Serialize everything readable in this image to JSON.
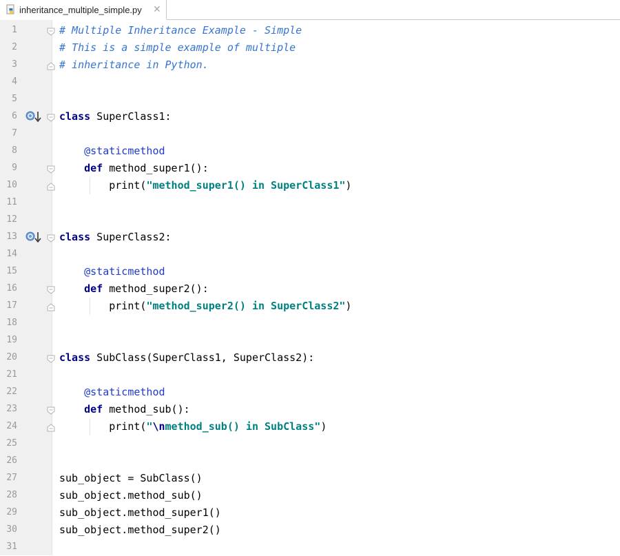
{
  "tab": {
    "filename": "inheritance_multiple_simple.py",
    "close": "✕"
  },
  "icons": {
    "file": "python-file-icon",
    "override": "override-method-icon"
  },
  "colors": {
    "keyword": "#000080",
    "comment": "#3574d1",
    "string": "#008080",
    "decorator": "#1e3bcc",
    "gutter": "#f0f0f0",
    "line_number": "#999999"
  },
  "lines": [
    {
      "n": "1",
      "tokens": [
        {
          "t": "# Multiple Inheritance Example - Simple",
          "c": "cm"
        }
      ]
    },
    {
      "n": "2",
      "tokens": [
        {
          "t": "# This is a simple example of multiple",
          "c": "cm"
        }
      ]
    },
    {
      "n": "3",
      "tokens": [
        {
          "t": "# inheritance in Python.",
          "c": "cm"
        }
      ]
    },
    {
      "n": "4",
      "tokens": []
    },
    {
      "n": "5",
      "tokens": []
    },
    {
      "n": "6",
      "tokens": [
        {
          "t": "class",
          "c": "kw"
        },
        {
          "t": " SuperClass1:",
          "c": "fn"
        }
      ]
    },
    {
      "n": "7",
      "tokens": []
    },
    {
      "n": "8",
      "tokens": [
        {
          "t": "    ",
          "c": "fn"
        },
        {
          "t": "@staticmethod",
          "c": "dec"
        }
      ]
    },
    {
      "n": "9",
      "tokens": [
        {
          "t": "    ",
          "c": "fn"
        },
        {
          "t": "def",
          "c": "kw"
        },
        {
          "t": " method_super1():",
          "c": "fn"
        }
      ]
    },
    {
      "n": "10",
      "tokens": [
        {
          "t": "        print(",
          "c": "fn"
        },
        {
          "t": "\"method_super1() in SuperClass1\"",
          "c": "str"
        },
        {
          "t": ")",
          "c": "fn"
        }
      ]
    },
    {
      "n": "11",
      "tokens": []
    },
    {
      "n": "12",
      "tokens": []
    },
    {
      "n": "13",
      "tokens": [
        {
          "t": "class",
          "c": "kw"
        },
        {
          "t": " SuperClass2:",
          "c": "fn"
        }
      ]
    },
    {
      "n": "14",
      "tokens": []
    },
    {
      "n": "15",
      "tokens": [
        {
          "t": "    ",
          "c": "fn"
        },
        {
          "t": "@staticmethod",
          "c": "dec"
        }
      ]
    },
    {
      "n": "16",
      "tokens": [
        {
          "t": "    ",
          "c": "fn"
        },
        {
          "t": "def",
          "c": "kw"
        },
        {
          "t": " method_super2():",
          "c": "fn"
        }
      ]
    },
    {
      "n": "17",
      "tokens": [
        {
          "t": "        print(",
          "c": "fn"
        },
        {
          "t": "\"method_super2() in SuperClass2\"",
          "c": "str"
        },
        {
          "t": ")",
          "c": "fn"
        }
      ]
    },
    {
      "n": "18",
      "tokens": []
    },
    {
      "n": "19",
      "tokens": []
    },
    {
      "n": "20",
      "tokens": [
        {
          "t": "class",
          "c": "kw"
        },
        {
          "t": " SubClass(SuperClass1, SuperClass2):",
          "c": "fn"
        }
      ]
    },
    {
      "n": "21",
      "tokens": []
    },
    {
      "n": "22",
      "tokens": [
        {
          "t": "    ",
          "c": "fn"
        },
        {
          "t": "@staticmethod",
          "c": "dec"
        }
      ]
    },
    {
      "n": "23",
      "tokens": [
        {
          "t": "    ",
          "c": "fn"
        },
        {
          "t": "def",
          "c": "kw"
        },
        {
          "t": " method_sub():",
          "c": "fn"
        }
      ]
    },
    {
      "n": "24",
      "tokens": [
        {
          "t": "        print(",
          "c": "fn"
        },
        {
          "t": "\"",
          "c": "str"
        },
        {
          "t": "\\n",
          "c": "esc"
        },
        {
          "t": "method_sub() in SubClass\"",
          "c": "str"
        },
        {
          "t": ")",
          "c": "fn"
        }
      ]
    },
    {
      "n": "25",
      "tokens": []
    },
    {
      "n": "26",
      "tokens": []
    },
    {
      "n": "27",
      "tokens": [
        {
          "t": "sub_object = SubClass()",
          "c": "fn"
        }
      ]
    },
    {
      "n": "28",
      "tokens": [
        {
          "t": "sub_object.method_sub()",
          "c": "fn"
        }
      ]
    },
    {
      "n": "29",
      "tokens": [
        {
          "t": "sub_object.method_super1()",
          "c": "fn"
        }
      ]
    },
    {
      "n": "30",
      "tokens": [
        {
          "t": "sub_object.method_super2()",
          "c": "fn"
        }
      ]
    },
    {
      "n": "31",
      "tokens": []
    }
  ]
}
